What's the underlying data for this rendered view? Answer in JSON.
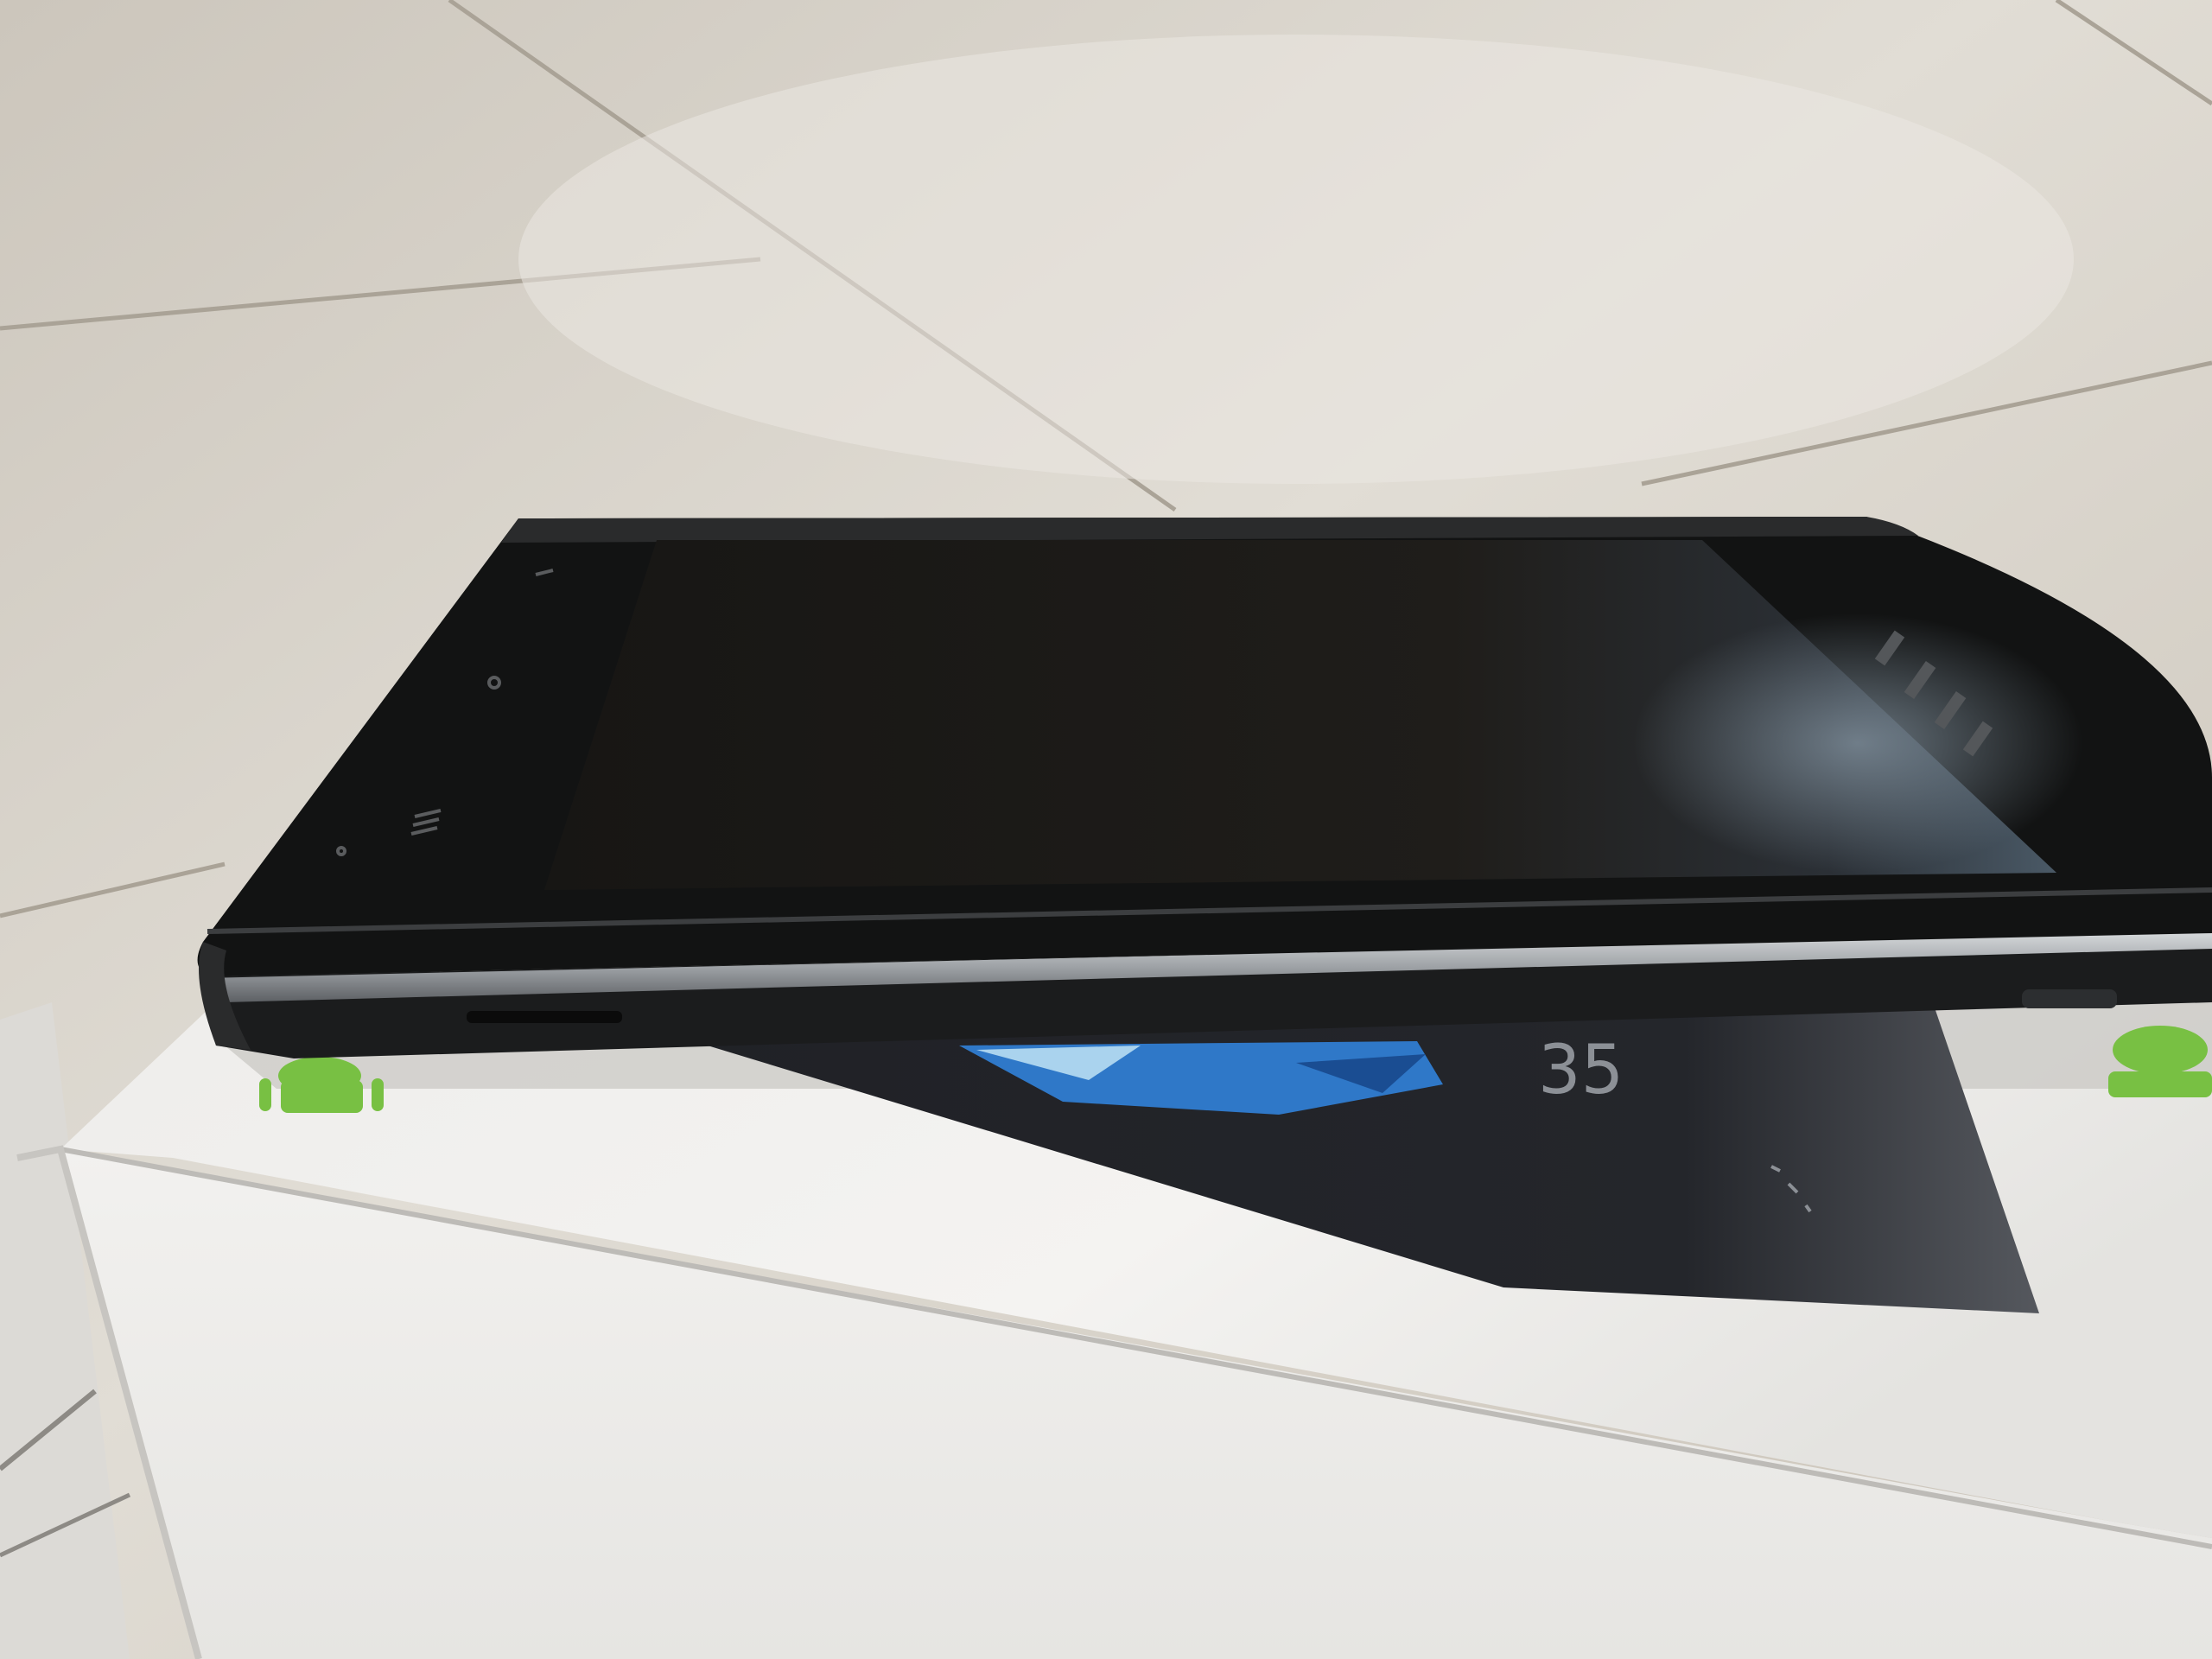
{
  "scene": {
    "colors": {
      "floor_light": "#e2ded6",
      "floor_mid": "#d2ccc2",
      "floor_dark": "#bdb6aa",
      "tile_seam": "#a79f93",
      "box_white": "#f1f0ee",
      "box_shadow": "#cfcdca",
      "phone_body": "#141515",
      "phone_screen": "#1c1b19",
      "phone_chrome": "#b9bcbf",
      "screen_reflection": "#6f7f8c",
      "print_dark": "#1d1e22",
      "print_blue": "#2f78c8",
      "android_green": "#78c043"
    },
    "box_print": {
      "number": "35"
    }
  }
}
